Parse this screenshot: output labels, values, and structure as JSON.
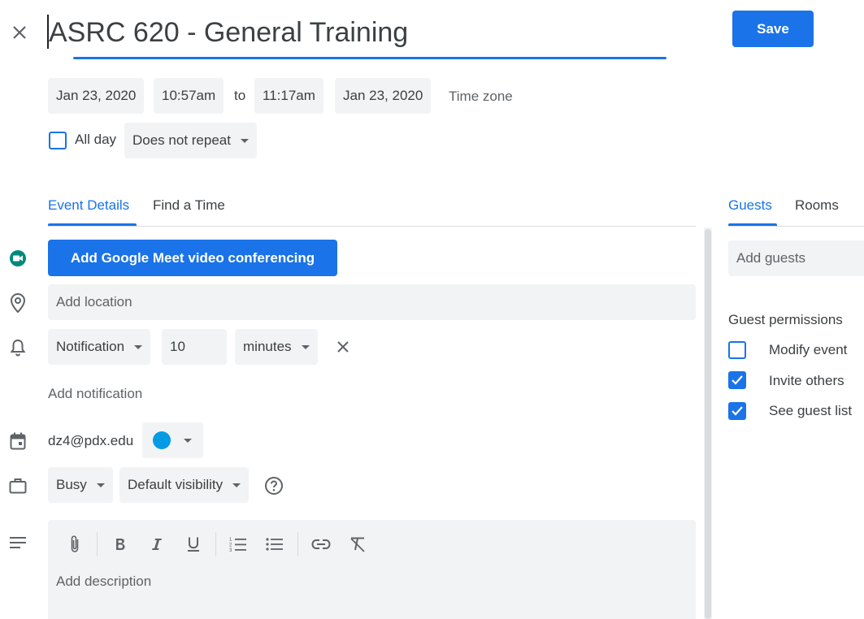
{
  "header": {
    "title": "ASRC 620 - General Training",
    "save_label": "Save",
    "close_icon": "close-icon"
  },
  "datetime": {
    "start_date": "Jan 23, 2020",
    "start_time": "10:57am",
    "to_label": "to",
    "end_time": "11:17am",
    "end_date": "Jan 23, 2020",
    "timezone_label": "Time zone",
    "all_day_label": "All day",
    "all_day_checked": false,
    "repeat_label": "Does not repeat"
  },
  "tabs": {
    "event_details": "Event Details",
    "find_time": "Find a Time",
    "active": "Event Details"
  },
  "details": {
    "meet_button": "Add Google Meet video conferencing",
    "location_placeholder": "Add location",
    "notification_type": "Notification",
    "notification_value": "10",
    "notification_unit": "minutes",
    "add_notification": "Add notification",
    "calendar_owner": "dz4@pdx.edu",
    "calendar_color": "#039be5",
    "availability": "Busy",
    "visibility": "Default visibility",
    "description_placeholder": "Add description"
  },
  "guests_panel": {
    "tab_guests": "Guests",
    "tab_rooms": "Rooms",
    "add_guests_placeholder": "Add guests",
    "permissions_title": "Guest permissions",
    "permissions": [
      {
        "label": "Modify event",
        "checked": false
      },
      {
        "label": "Invite others",
        "checked": true
      },
      {
        "label": "See guest list",
        "checked": true
      }
    ]
  },
  "colors": {
    "accent": "#1a73e8",
    "meet_green": "#00897b",
    "field_bg": "#f1f3f4"
  }
}
